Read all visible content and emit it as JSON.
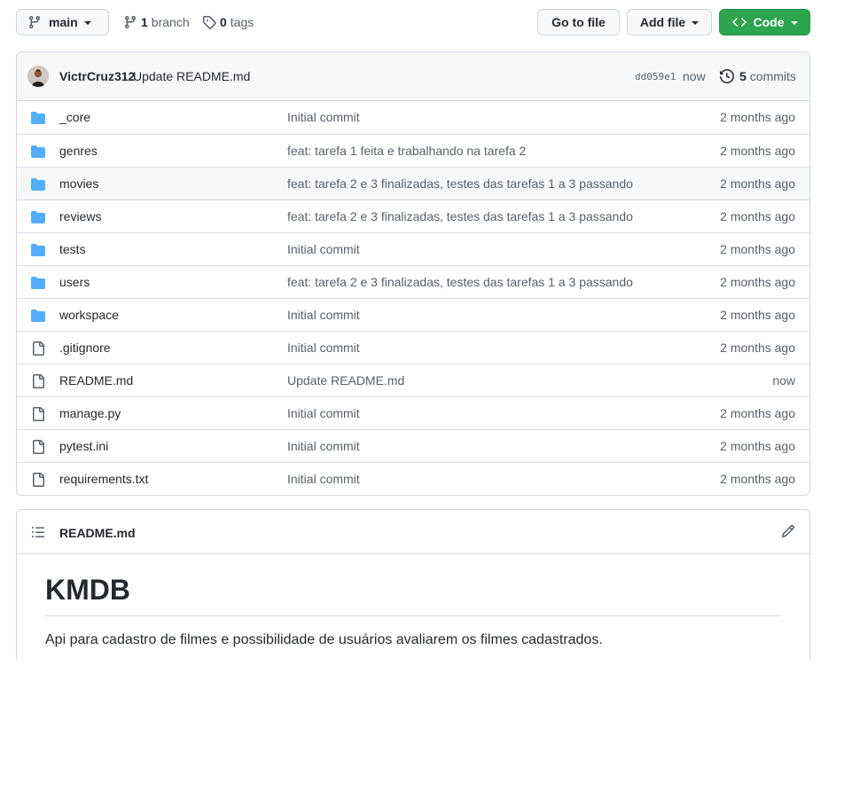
{
  "toolbar": {
    "branch_name": "main",
    "branch_count": "1",
    "branch_label": "branch",
    "tag_count": "0",
    "tag_label": "tags",
    "goto_label": "Go to file",
    "addfile_label": "Add file",
    "code_label": "Code",
    "accent_green": "#2da44e"
  },
  "commit": {
    "author": "VictrCruz312",
    "message": "Update README.md",
    "sha": "dd059e1",
    "time": "now",
    "commits_count": "5",
    "commits_label": "commits"
  },
  "files": [
    {
      "type": "dir",
      "name": "_core",
      "message": "Initial commit",
      "age": "2 months ago"
    },
    {
      "type": "dir",
      "name": "genres",
      "message": "feat: tarefa 1 feita e trabalhando na tarefa 2",
      "age": "2 months ago"
    },
    {
      "type": "dir",
      "name": "movies",
      "message": "feat: tarefa 2 e 3 finalizadas, testes das tarefas 1 a 3 passando",
      "age": "2 months ago"
    },
    {
      "type": "dir",
      "name": "reviews",
      "message": "feat: tarefa 2 e 3 finalizadas, testes das tarefas 1 a 3 passando",
      "age": "2 months ago"
    },
    {
      "type": "dir",
      "name": "tests",
      "message": "Initial commit",
      "age": "2 months ago"
    },
    {
      "type": "dir",
      "name": "users",
      "message": "feat: tarefa 2 e 3 finalizadas, testes das tarefas 1 a 3 passando",
      "age": "2 months ago"
    },
    {
      "type": "dir",
      "name": "workspace",
      "message": "Initial commit",
      "age": "2 months ago"
    },
    {
      "type": "file",
      "name": ".gitignore",
      "message": "Initial commit",
      "age": "2 months ago"
    },
    {
      "type": "file",
      "name": "README.md",
      "message": "Update README.md",
      "age": "now"
    },
    {
      "type": "file",
      "name": "manage.py",
      "message": "Initial commit",
      "age": "2 months ago"
    },
    {
      "type": "file",
      "name": "pytest.ini",
      "message": "Initial commit",
      "age": "2 months ago"
    },
    {
      "type": "file",
      "name": "requirements.txt",
      "message": "Initial commit",
      "age": "2 months ago"
    }
  ],
  "readme": {
    "filename": "README.md",
    "heading": "KMDB",
    "paragraph": "Api para cadastro de filmes e possibilidade de usuários avaliarem os filmes cadastrados."
  },
  "colors": {
    "folder": "#54aeff",
    "file_icon": "#57606a"
  }
}
